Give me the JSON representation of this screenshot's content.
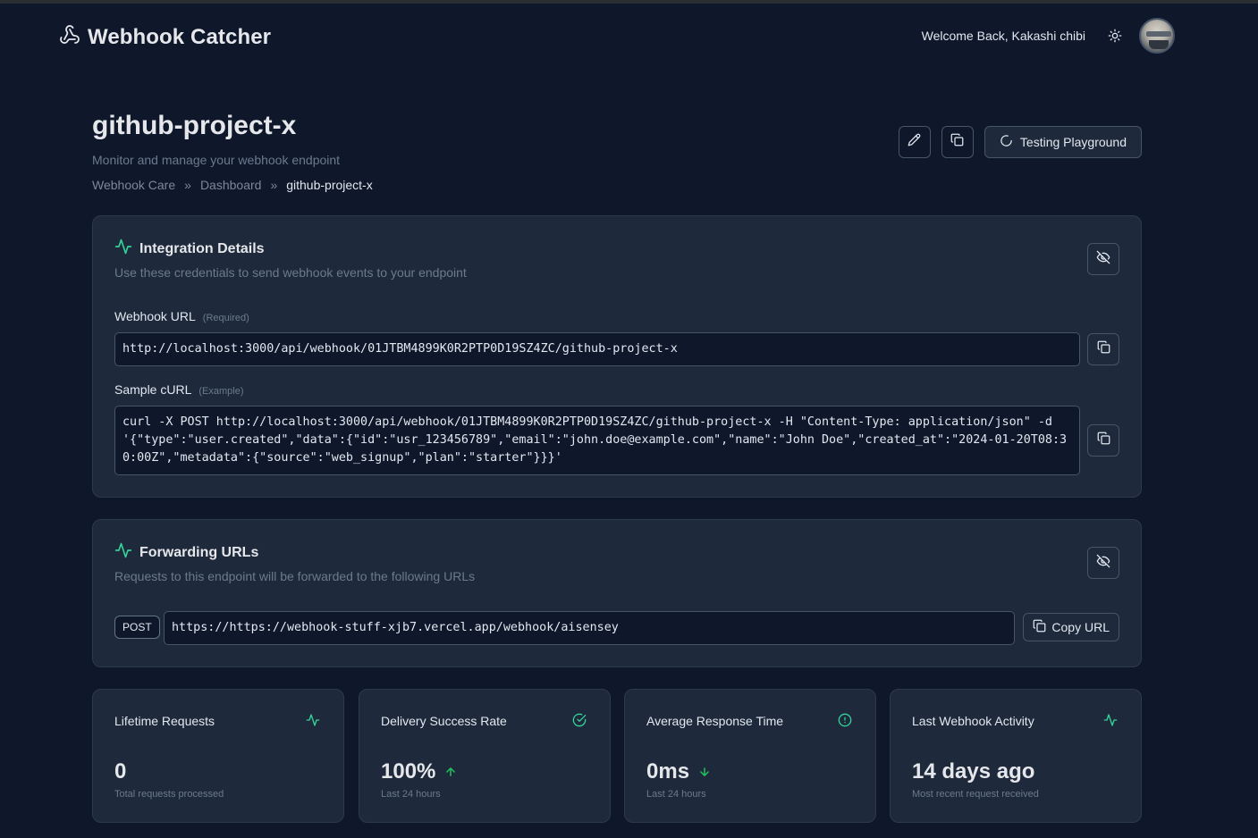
{
  "navbar": {
    "brand": "Webhook Catcher",
    "brand_icon": "webhook-icon",
    "welcome": "Welcome Back, Kakashi chibi",
    "theme_icon": "sun-icon"
  },
  "header": {
    "title": "github-project-x",
    "subtitle": "Monitor and manage your webhook endpoint",
    "breadcrumb": [
      "Webhook Care",
      "Dashboard",
      "github-project-x"
    ],
    "breadcrumb_separator": "»",
    "playground_label": "Testing Playground"
  },
  "integration": {
    "title": "Integration Details",
    "description": "Use these credentials to send webhook events to your endpoint",
    "webhook_url_label": "Webhook URL",
    "webhook_url_hint": "(Required)",
    "webhook_url": "http://localhost:3000/api/webhook/01JTBM4899K0R2PTP0D19SZ4ZC/github-project-x",
    "curl_label": "Sample cURL",
    "curl_hint": "(Example)",
    "curl": "curl -X POST http://localhost:3000/api/webhook/01JTBM4899K0R2PTP0D19SZ4ZC/github-project-x -H \"Content-Type: application/json\" -d '{\"type\":\"user.created\",\"data\":{\"id\":\"usr_123456789\",\"email\":\"john.doe@example.com\",\"name\":\"John Doe\",\"created_at\":\"2024-01-20T08:30:00Z\",\"metadata\":{\"source\":\"web_signup\",\"plan\":\"starter\"}}}'"
  },
  "forwarding": {
    "title": "Forwarding URLs",
    "description": "Requests to this endpoint will be forwarded to the following URLs",
    "method": "POST",
    "url": "https://https://webhook-stuff-xjb7.vercel.app/webhook/aisensey",
    "copy_label": "Copy URL"
  },
  "stats": [
    {
      "label": "Lifetime Requests",
      "value": "0",
      "sub": "Total requests processed",
      "icon": "activity-icon"
    },
    {
      "label": "Delivery Success Rate",
      "value": "100%",
      "sub": "Last 24 hours",
      "icon": "check-circle-icon",
      "trend": "up"
    },
    {
      "label": "Average Response Time",
      "value": "0ms",
      "sub": "Last 24 hours",
      "icon": "alert-circle-icon",
      "trend": "down"
    },
    {
      "label": "Last Webhook Activity",
      "value": "14 days ago",
      "sub": "Most recent request received",
      "icon": "activity-icon"
    }
  ],
  "colors": {
    "background": "#0f172a",
    "card": "#1e293b",
    "border": "#475569",
    "accent": "#34d399",
    "muted_text": "#6b7a8f"
  }
}
